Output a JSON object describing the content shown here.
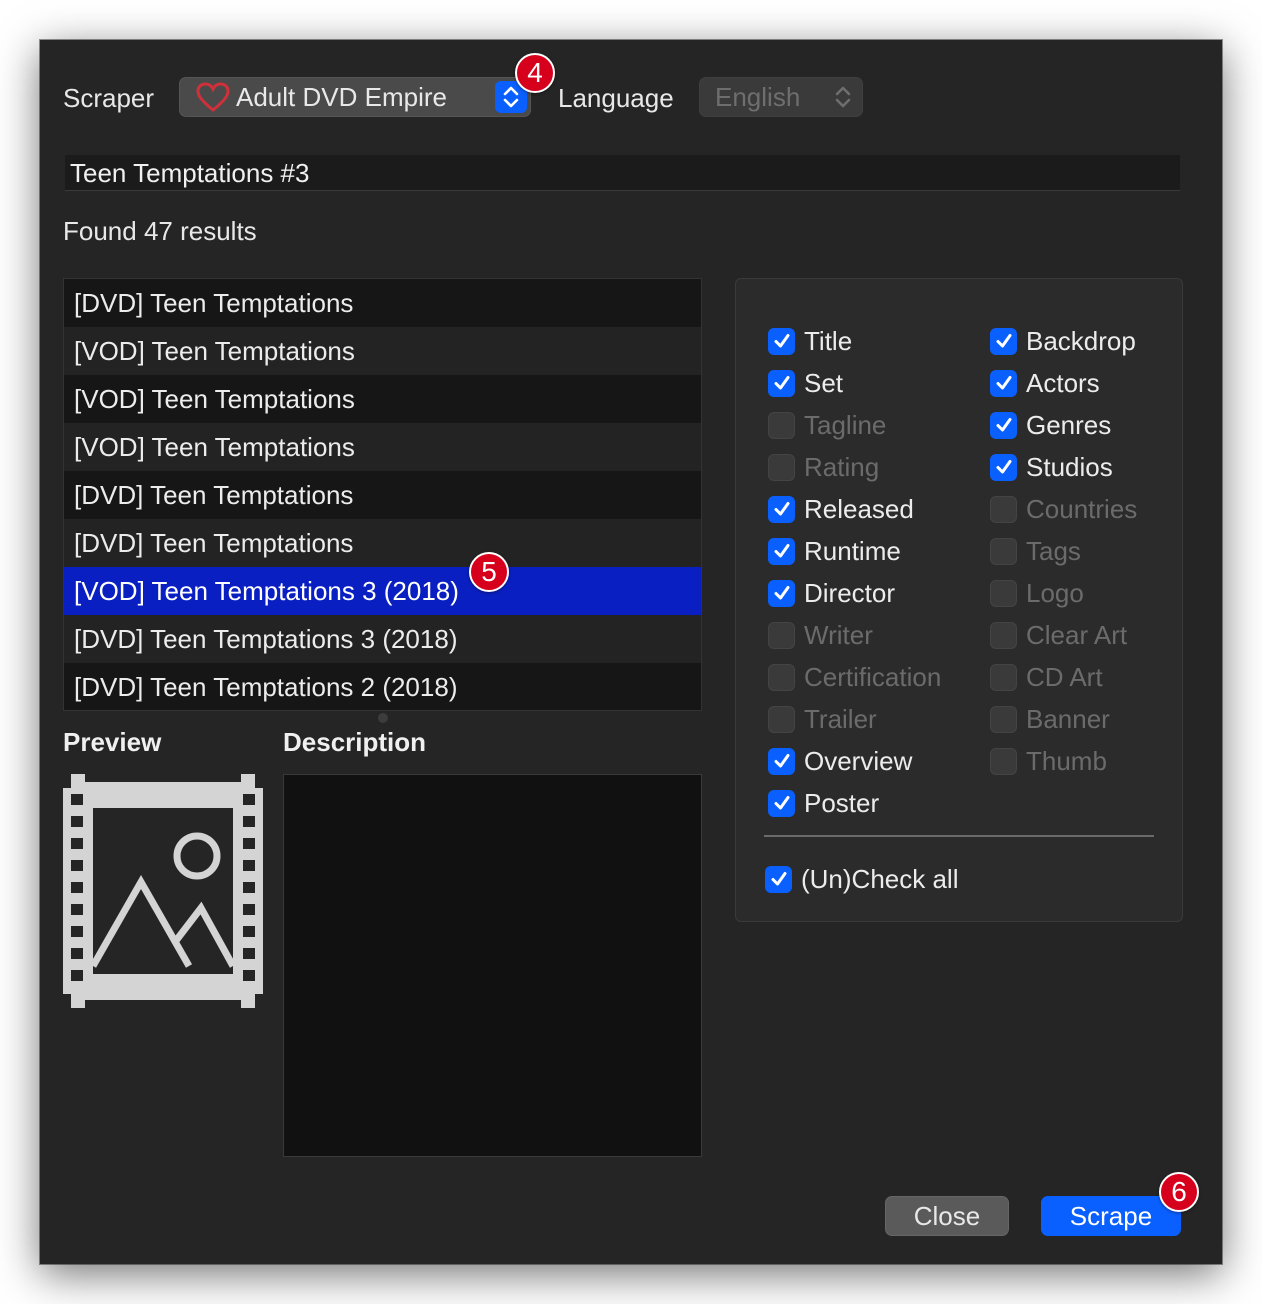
{
  "header": {
    "scraper_label": "Scraper",
    "scraper_value": "Adult DVD Empire",
    "language_label": "Language",
    "language_value": "English"
  },
  "search": {
    "query": "Teen Temptations #3"
  },
  "results": {
    "summary": "Found 47 results",
    "items": [
      "[DVD] Teen Temptations",
      "[VOD] Teen Temptations",
      "[VOD] Teen Temptations",
      "[VOD] Teen Temptations",
      "[DVD] Teen Temptations",
      "[DVD] Teen Temptations",
      "[VOD] Teen Temptations 3 (2018)",
      "[DVD] Teen Temptations 3 (2018)",
      "[DVD] Teen Temptations 2 (2018)"
    ],
    "selected_index": 6
  },
  "preview": {
    "label": "Preview"
  },
  "description": {
    "label": "Description"
  },
  "options": {
    "left": [
      {
        "label": "Title",
        "checked": true
      },
      {
        "label": "Set",
        "checked": true
      },
      {
        "label": "Tagline",
        "checked": false
      },
      {
        "label": "Rating",
        "checked": false
      },
      {
        "label": "Released",
        "checked": true
      },
      {
        "label": "Runtime",
        "checked": true
      },
      {
        "label": "Director",
        "checked": true
      },
      {
        "label": "Writer",
        "checked": false
      },
      {
        "label": "Certification",
        "checked": false
      },
      {
        "label": "Trailer",
        "checked": false
      },
      {
        "label": "Overview",
        "checked": true
      },
      {
        "label": "Poster",
        "checked": true
      }
    ],
    "right": [
      {
        "label": "Backdrop",
        "checked": true
      },
      {
        "label": "Actors",
        "checked": true
      },
      {
        "label": "Genres",
        "checked": true
      },
      {
        "label": "Studios",
        "checked": true
      },
      {
        "label": "Countries",
        "checked": false
      },
      {
        "label": "Tags",
        "checked": false
      },
      {
        "label": "Logo",
        "checked": false
      },
      {
        "label": "Clear Art",
        "checked": false
      },
      {
        "label": "CD Art",
        "checked": false
      },
      {
        "label": "Banner",
        "checked": false
      },
      {
        "label": "Thumb",
        "checked": false
      }
    ],
    "check_all": {
      "label": "(Un)Check all",
      "checked": true
    }
  },
  "buttons": {
    "close": "Close",
    "scrape": "Scrape"
  },
  "badges": {
    "scraper": "4",
    "selection": "5",
    "scrape": "6"
  },
  "colors": {
    "accent": "#0a60ff",
    "selection": "#0a1fc2",
    "badge": "#d6001c",
    "heart": "#d0303a"
  }
}
